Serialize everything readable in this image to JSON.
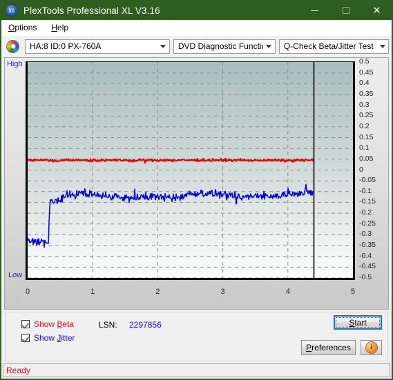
{
  "window": {
    "title": "PlexTools Professional XL V3.16",
    "icon": "disc-logo-icon",
    "minimize": "–",
    "maximize": "□",
    "close": "×"
  },
  "menubar": {
    "items": [
      {
        "label": "Options",
        "accel": "O"
      },
      {
        "label": "Help",
        "accel": "H"
      }
    ]
  },
  "toolbar": {
    "drive_icon": "dvd-disc-icon",
    "drive_select": {
      "value": "HA:8 ID:0  PX-760A",
      "options": [
        "HA:8 ID:0  PX-760A"
      ]
    },
    "function_select": {
      "value": "DVD Diagnostic Functions",
      "options": [
        "DVD Diagnostic Functions"
      ]
    },
    "test_select": {
      "value": "Q-Check Beta/Jitter Test",
      "options": [
        "Q-Check Beta/Jitter Test"
      ]
    }
  },
  "chart_data": {
    "type": "line",
    "title": "Q-Check Beta/Jitter Test",
    "xlabel": "",
    "ylabel": "",
    "xlim": [
      0,
      5
    ],
    "ylim": [
      -0.5,
      0.5
    ],
    "xticks": [
      0,
      1,
      2,
      3,
      4,
      5
    ],
    "xtick_labels": [
      "0",
      "1",
      "2",
      "3",
      "4",
      "5"
    ],
    "yticks": [
      0.5,
      0.45,
      0.4,
      0.35,
      0.3,
      0.25,
      0.2,
      0.15,
      0.1,
      0.05,
      0,
      -0.05,
      -0.1,
      -0.15,
      -0.2,
      -0.25,
      -0.3,
      -0.35,
      -0.4,
      -0.45,
      -0.5
    ],
    "ytick_labels": [
      "0.5",
      "0.45",
      "0.4",
      "0.35",
      "0.3",
      "0.25",
      "0.2",
      "0.15",
      "0.1",
      "0.05",
      "0",
      "-0.05",
      "-0.1",
      "-0.15",
      "-0.2",
      "-0.25",
      "-0.3",
      "-0.35",
      "-0.4",
      "-0.45",
      "-0.5"
    ],
    "axis_left_label": "High",
    "axis_bottom_label": "Low",
    "grid": true,
    "grid_style": "dashed",
    "data_end_marker_x": 4.4,
    "series": [
      {
        "name": "Beta",
        "color": "#ee0000",
        "x": [
          0.0,
          0.1,
          0.2,
          0.3,
          0.35,
          0.4,
          0.5,
          0.6,
          0.7,
          0.8,
          0.9,
          1.0,
          1.1,
          1.2,
          1.3,
          1.4,
          1.5,
          1.6,
          1.7,
          1.8,
          1.9,
          2.0,
          2.1,
          2.2,
          2.3,
          2.4,
          2.5,
          2.6,
          2.7,
          2.8,
          2.9,
          3.0,
          3.1,
          3.2,
          3.3,
          3.4,
          3.5,
          3.6,
          3.7,
          3.8,
          3.9,
          4.0,
          4.1,
          4.2,
          4.3,
          4.4
        ],
        "y": [
          0.048,
          0.046,
          0.047,
          0.046,
          0.045,
          0.044,
          0.045,
          0.046,
          0.045,
          0.046,
          0.045,
          0.046,
          0.045,
          0.046,
          0.045,
          0.045,
          0.046,
          0.045,
          0.046,
          0.045,
          0.046,
          0.045,
          0.046,
          0.045,
          0.045,
          0.046,
          0.045,
          0.046,
          0.045,
          0.046,
          0.045,
          0.045,
          0.046,
          0.045,
          0.045,
          0.044,
          0.045,
          0.045,
          0.045,
          0.044,
          0.045,
          0.045,
          0.045,
          0.046,
          0.046,
          0.047
        ],
        "noise": 0.006
      },
      {
        "name": "Jitter",
        "color": "#0000ee",
        "x": [
          0.0,
          0.05,
          0.1,
          0.15,
          0.2,
          0.25,
          0.3,
          0.32,
          0.34,
          0.36,
          0.4,
          0.45,
          0.5,
          0.55,
          0.6,
          0.65,
          0.7,
          0.75,
          0.8,
          0.85,
          0.9,
          0.95,
          1.0,
          1.05,
          1.1,
          1.15,
          1.2,
          1.25,
          1.3,
          1.35,
          1.4,
          1.45,
          1.5,
          1.55,
          1.6,
          1.65,
          1.7,
          1.75,
          1.8,
          1.85,
          1.9,
          1.95,
          2.0,
          2.05,
          2.1,
          2.15,
          2.2,
          2.25,
          2.3,
          2.35,
          2.4,
          2.45,
          2.5,
          2.55,
          2.6,
          2.65,
          2.7,
          2.75,
          2.8,
          2.85,
          2.9,
          2.95,
          3.0,
          3.05,
          3.1,
          3.15,
          3.2,
          3.25,
          3.3,
          3.35,
          3.4,
          3.45,
          3.5,
          3.55,
          3.6,
          3.65,
          3.7,
          3.75,
          3.8,
          3.85,
          3.9,
          3.95,
          4.0,
          4.05,
          4.1,
          4.15,
          4.2,
          4.25,
          4.3,
          4.35,
          4.4
        ],
        "y": [
          -0.325,
          -0.33,
          -0.328,
          -0.332,
          -0.326,
          -0.33,
          -0.334,
          -0.345,
          -0.16,
          -0.15,
          -0.145,
          -0.14,
          -0.137,
          -0.128,
          -0.118,
          -0.122,
          -0.112,
          -0.108,
          -0.11,
          -0.106,
          -0.113,
          -0.109,
          -0.115,
          -0.112,
          -0.118,
          -0.12,
          -0.116,
          -0.125,
          -0.122,
          -0.118,
          -0.126,
          -0.13,
          -0.128,
          -0.133,
          -0.129,
          -0.126,
          -0.13,
          -0.127,
          -0.124,
          -0.128,
          -0.126,
          -0.122,
          -0.124,
          -0.127,
          -0.129,
          -0.125,
          -0.128,
          -0.131,
          -0.127,
          -0.124,
          -0.118,
          -0.112,
          -0.108,
          -0.11,
          -0.106,
          -0.109,
          -0.107,
          -0.11,
          -0.108,
          -0.112,
          -0.11,
          -0.114,
          -0.116,
          -0.119,
          -0.122,
          -0.126,
          -0.129,
          -0.133,
          -0.13,
          -0.126,
          -0.122,
          -0.118,
          -0.12,
          -0.116,
          -0.113,
          -0.117,
          -0.12,
          -0.124,
          -0.122,
          -0.118,
          -0.115,
          -0.112,
          -0.11,
          -0.107,
          -0.105,
          -0.108,
          -0.106,
          -0.104,
          -0.103,
          -0.105,
          -0.104
        ],
        "noise": 0.022
      }
    ]
  },
  "controls": {
    "show_beta": {
      "label": "Show Beta",
      "accel": "B",
      "checked": true,
      "color": "#ee1111"
    },
    "show_jitter": {
      "label": "Show Jitter",
      "accel": "J",
      "checked": true,
      "color": "#1111ee"
    },
    "lsn_label": "LSN:",
    "lsn_value": "2297856",
    "start_button": "Start",
    "start_accel": "S",
    "preferences_button": "Preferences",
    "preferences_accel": "P",
    "info_button": "info-icon",
    "info_glyph": "i"
  },
  "statusbar": {
    "text": "Ready"
  },
  "colors": {
    "title_bar": "#2e5e20",
    "beta_trace": "#ee0000",
    "jitter_trace": "#0000ee",
    "status_text": "#ee1111",
    "accent_focus": "#1a73c8"
  }
}
